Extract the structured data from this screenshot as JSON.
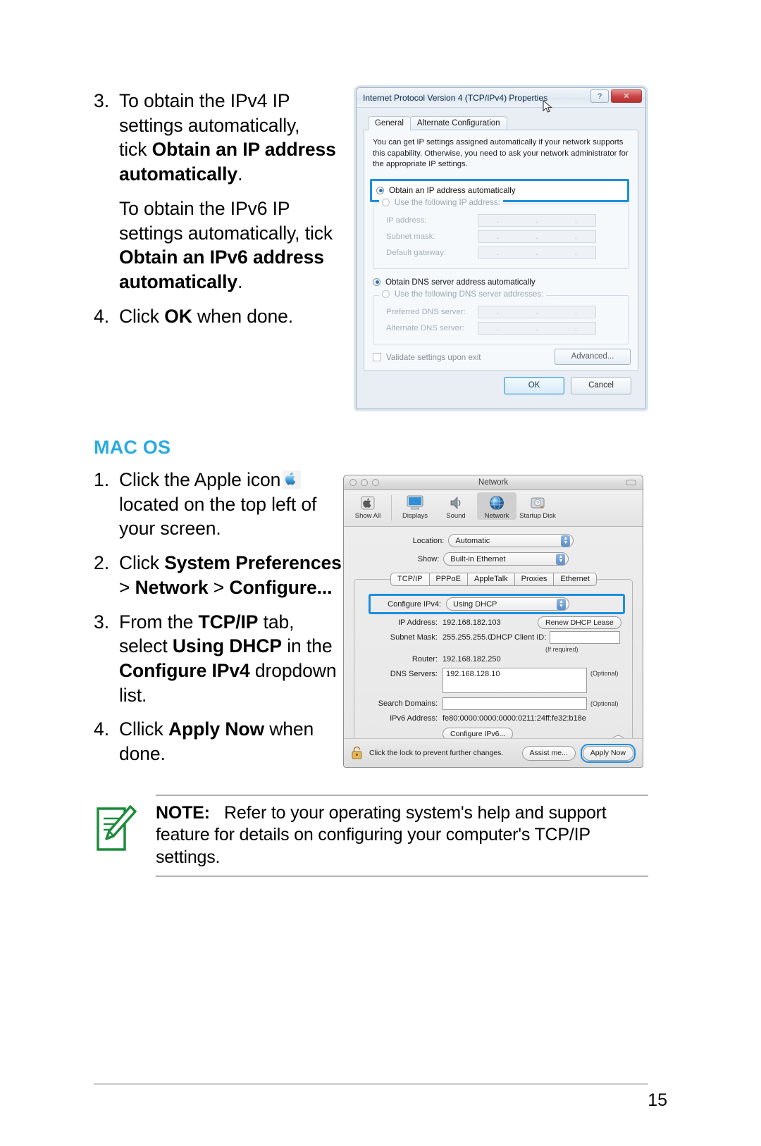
{
  "left_column": {
    "steps": [
      {
        "num": "3.",
        "segments": [
          {
            "t": "To obtain the IPv4 IP settings automatically, tick ",
            "b": false
          },
          {
            "t": "Obtain an IP address automatically",
            "b": true
          },
          {
            "t": ".",
            "b": false
          }
        ]
      }
    ],
    "step3_line1": "To obtain the IPv4 IP",
    "step3_line2": "settings automatically,",
    "step3_line3_pre": "tick ",
    "step3_bold_a": "Obtain an IP address",
    "step3_bold_b": "automatically",
    "step3_period": ".",
    "ipv6_line1": "To obtain the IPv6 IP",
    "ipv6_line2": "settings automatically, tick",
    "ipv6_bold_a": "Obtain an IPv6 address",
    "ipv6_bold_b": "automatically",
    "ipv6_period": ".",
    "step4_num": "4.",
    "step4_pre": "Click ",
    "step4_bold": "OK",
    "step4_post": " when done.",
    "step3_num": "3."
  },
  "mac_section": {
    "heading": "MAC OS",
    "step1": {
      "num": "1.",
      "pre": "Click the Apple icon",
      "post": "located on the top left of your screen.",
      "icon": "apple-icon"
    },
    "step2": {
      "num": "2.",
      "pre": "Click ",
      "b1": "System Preferences",
      "sep1": " > ",
      "b2": "Network",
      "sep2": " > ",
      "b3": "Configure..."
    },
    "step3": {
      "num": "3.",
      "pre": "From the ",
      "b1": "TCP/IP",
      "mid1": " tab, select ",
      "b2": "Using DHCP",
      "mid2": " in the ",
      "b3": "Configure IPv4",
      "post": " dropdown list."
    },
    "step4": {
      "num": "4.",
      "pre": "Cllick ",
      "b1": "Apply Now",
      "post": " when done."
    }
  },
  "windows_dialog": {
    "title": "Internet Protocol Version 4 (TCP/IPv4) Properties",
    "help_label": "?",
    "close_label": "✕",
    "tabs": [
      {
        "label": "General",
        "active": true
      },
      {
        "label": "Alternate Configuration",
        "active": false
      }
    ],
    "blurb": "You can get IP settings assigned automatically if your network supports this capability. Otherwise, you need to ask your network administrator for the appropriate IP settings.",
    "radio_auto_ip": "Obtain an IP address automatically",
    "radio_manual_ip": "Use the following IP address:",
    "fields_ip": [
      {
        "label": "IP address:",
        "value": ""
      },
      {
        "label": "Subnet mask:",
        "value": ""
      },
      {
        "label": "Default gateway:",
        "value": ""
      }
    ],
    "radio_auto_dns": "Obtain DNS server address automatically",
    "radio_manual_dns": "Use the following DNS server addresses:",
    "fields_dns": [
      {
        "label": "Preferred DNS server:",
        "value": ""
      },
      {
        "label": "Alternate DNS server:",
        "value": ""
      }
    ],
    "validate_label": "Validate settings upon exit",
    "advanced_label": "Advanced...",
    "ok_label": "OK",
    "cancel_label": "Cancel"
  },
  "mac_dialog": {
    "title": "Network",
    "toolbar": [
      {
        "label": "Show All",
        "icon": "show-all-icon",
        "selected": false
      },
      {
        "label": "Displays",
        "icon": "displays-icon",
        "selected": false
      },
      {
        "label": "Sound",
        "icon": "sound-icon",
        "selected": false
      },
      {
        "label": "Network",
        "icon": "network-icon",
        "selected": true
      },
      {
        "label": "Startup Disk",
        "icon": "startup-disk-icon",
        "selected": false
      }
    ],
    "location_label": "Location:",
    "location_value": "Automatic",
    "show_label": "Show:",
    "show_value": "Built-in Ethernet",
    "tabs": [
      {
        "label": "TCP/IP",
        "active": true
      },
      {
        "label": "PPPoE",
        "active": false
      },
      {
        "label": "AppleTalk",
        "active": false
      },
      {
        "label": "Proxies",
        "active": false
      },
      {
        "label": "Ethernet",
        "active": false
      }
    ],
    "configure_ipv4_label": "Configure IPv4:",
    "configure_ipv4_value": "Using DHCP",
    "ip_address_label": "IP Address:",
    "ip_address_value": "192.168.182.103",
    "renew_dhcp_label": "Renew DHCP Lease",
    "subnet_mask_label": "Subnet Mask:",
    "subnet_mask_value": "255.255.255.0",
    "dhcp_client_id_label": "DHCP Client ID:",
    "dhcp_client_id_value": "",
    "if_required": "(If required)",
    "router_label": "Router:",
    "router_value": "192.168.182.250",
    "dns_servers_label": "DNS Servers:",
    "dns_servers_value": "192.168.128.10",
    "optional_1": "(Optional)",
    "search_domains_label": "Search Domains:",
    "search_domains_value": "",
    "optional_2": "(Optional)",
    "ipv6_address_label": "IPv6 Address:",
    "ipv6_address_value": "fe80:0000:0000:0000:0211:24ff:fe32:b18e",
    "configure_ipv6_label": "Configure IPv6...",
    "help_label": "?",
    "lock_text": "Click the lock to prevent further changes.",
    "assist_label": "Assist me...",
    "apply_label": "Apply Now"
  },
  "note": {
    "label": "NOTE:",
    "body": "Refer to your operating system's help and support feature for details on configuring your computer's TCP/IP settings."
  },
  "footer": {
    "page_number": "15"
  },
  "colors": {
    "heading_cyan": "#29ABE2",
    "highlight_blue": "#1C8EE0",
    "note_green": "#1E8B3C"
  }
}
